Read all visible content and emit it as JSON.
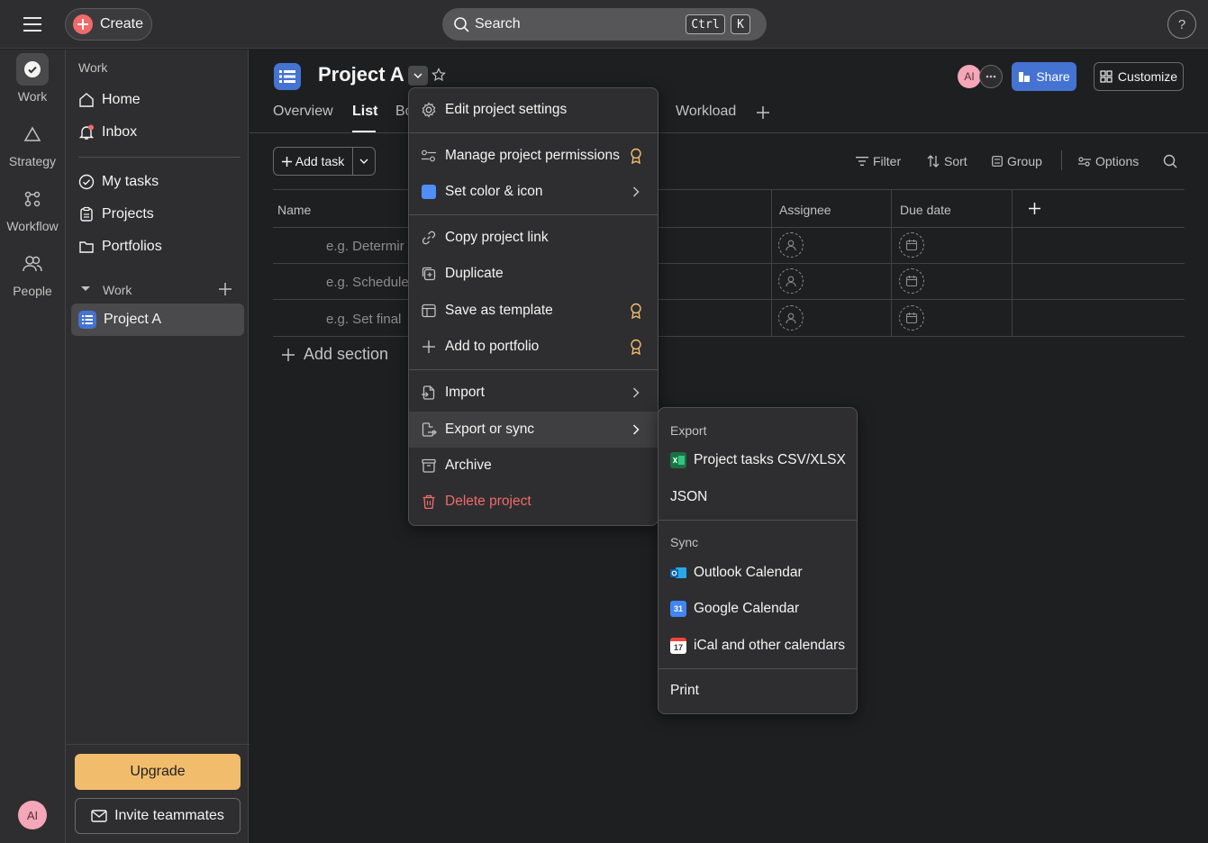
{
  "topbar": {
    "create_label": "Create",
    "search_placeholder": "Search",
    "shortcut_ctrl": "Ctrl",
    "shortcut_k": "K",
    "help_label": "?"
  },
  "rail": {
    "items": [
      {
        "label": "Work",
        "icon": "check-circle-icon"
      },
      {
        "label": "Strategy",
        "icon": "triangle-icon"
      },
      {
        "label": "Workflow",
        "icon": "workflow-icon"
      },
      {
        "label": "People",
        "icon": "people-icon"
      }
    ],
    "avatar_initials": "AI"
  },
  "sidebar": {
    "section_label": "Work",
    "items": [
      {
        "label": "Home",
        "icon": "home-icon"
      },
      {
        "label": "Inbox",
        "icon": "bell-icon"
      }
    ],
    "items2": [
      {
        "label": "My tasks",
        "icon": "check-circle-icon"
      },
      {
        "label": "Projects",
        "icon": "clipboard-icon"
      },
      {
        "label": "Portfolios",
        "icon": "folder-icon"
      }
    ],
    "team_label": "Work",
    "project_label": "Project A",
    "upgrade_label": "Upgrade",
    "invite_label": "Invite teammates"
  },
  "project": {
    "title": "Project A",
    "tabs": [
      "Overview",
      "List",
      "Bo",
      "Workload"
    ],
    "avatar_initials": "AI",
    "share_label": "Share",
    "customize_label": "Customize"
  },
  "toolbar": {
    "add_task_label": "Add task",
    "filter_label": "Filter",
    "sort_label": "Sort",
    "group_label": "Group",
    "options_label": "Options"
  },
  "table": {
    "columns": {
      "name": "Name",
      "assignee": "Assignee",
      "due": "Due date"
    },
    "rows": [
      "e.g. Determir",
      "e.g. Schedule",
      "e.g. Set final"
    ],
    "add_section_label": "Add section"
  },
  "menu": {
    "items": [
      {
        "label": "Edit project settings"
      },
      {
        "label": "Manage project permissions"
      },
      {
        "label": "Set color & icon"
      },
      {
        "label": "Copy project link"
      },
      {
        "label": "Duplicate"
      },
      {
        "label": "Save as template"
      },
      {
        "label": "Add to portfolio"
      },
      {
        "label": "Import"
      },
      {
        "label": "Export or sync"
      },
      {
        "label": "Archive"
      },
      {
        "label": "Delete project"
      }
    ]
  },
  "submenu": {
    "export_header": "Export",
    "csv_label": "Project tasks CSV/XLSX",
    "json_label": "JSON",
    "sync_header": "Sync",
    "outlook_label": "Outlook Calendar",
    "google_label": "Google Calendar",
    "google_badge": "31",
    "ical_label": "iCal and other calendars",
    "ical_badge": "17",
    "print_label": "Print"
  },
  "colors": {
    "accent": "#4573d2",
    "create": "#f06a6a",
    "upgrade": "#f1bd6c",
    "danger": "#f06a6a",
    "premium_icon": "#f1bd6c"
  }
}
